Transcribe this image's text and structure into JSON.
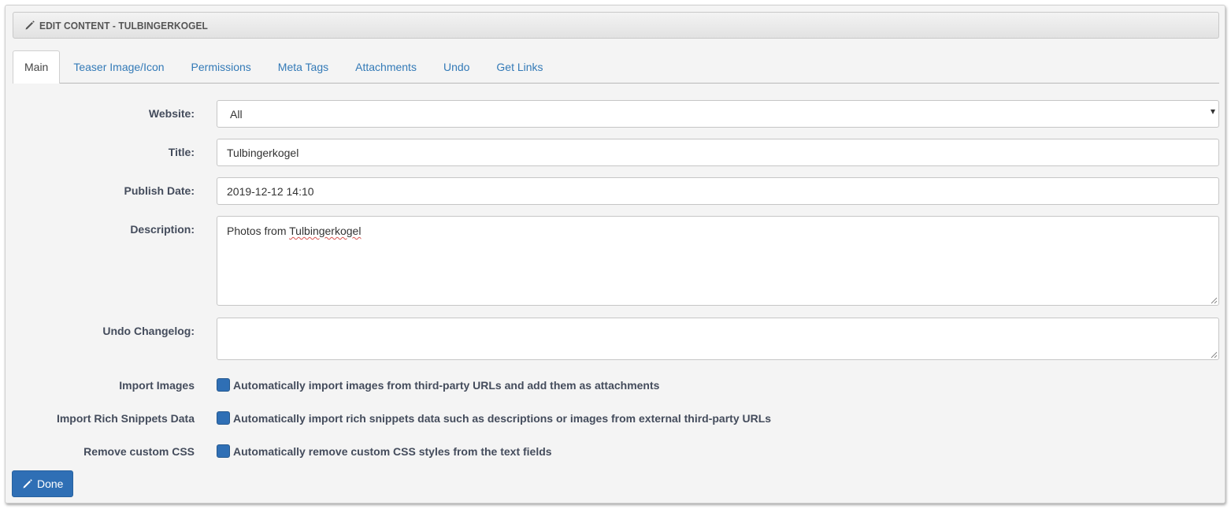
{
  "header": {
    "title": "EDIT CONTENT - TULBINGERKOGEL"
  },
  "tabs": [
    {
      "label": "Main",
      "active": true
    },
    {
      "label": "Teaser Image/Icon",
      "active": false
    },
    {
      "label": "Permissions",
      "active": false
    },
    {
      "label": "Meta Tags",
      "active": false
    },
    {
      "label": "Attachments",
      "active": false
    },
    {
      "label": "Undo",
      "active": false
    },
    {
      "label": "Get Links",
      "active": false
    }
  ],
  "form": {
    "website": {
      "label": "Website:",
      "value": "All"
    },
    "title": {
      "label": "Title:",
      "value": "Tulbingerkogel"
    },
    "publish_date": {
      "label": "Publish Date:",
      "value": "2019-12-12 14:10"
    },
    "description": {
      "label": "Description:",
      "value_prefix": "Photos from ",
      "value_misspelled": "Tulbingerkogel"
    },
    "undo_changelog": {
      "label": "Undo Changelog:",
      "value": ""
    },
    "import_images": {
      "label": "Import Images",
      "checkbox_text": "Automatically import images from third-party URLs and add them as attachments"
    },
    "import_snippets": {
      "label": "Import Rich Snippets Data",
      "checkbox_text": "Automatically import rich snippets data such as descriptions or images from external third-party URLs"
    },
    "remove_css": {
      "label": "Remove custom CSS",
      "checkbox_text": "Automatically remove custom CSS styles from the text fields"
    }
  },
  "actions": {
    "done_label": "Done"
  },
  "colors": {
    "primary": "#2f6fb5",
    "link": "#337ab7",
    "label": "#444c5c"
  }
}
